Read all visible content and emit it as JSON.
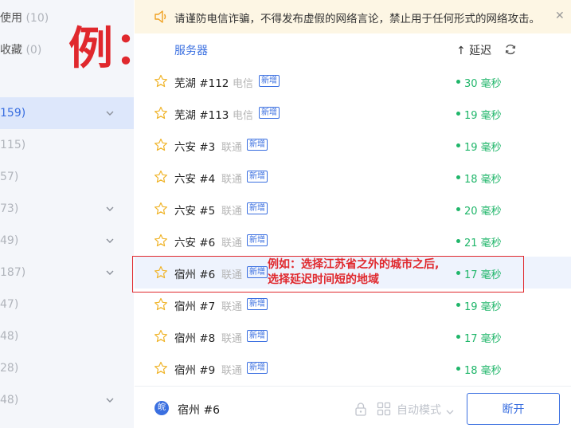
{
  "sidebar": {
    "items": [
      {
        "name": "使用",
        "count": "(10)"
      },
      {
        "name": "收藏",
        "count": "(0)"
      },
      {
        "name": "",
        "count": "159)"
      },
      {
        "name": "",
        "count": "115)"
      },
      {
        "name": "",
        "count": "57)"
      },
      {
        "name": "",
        "count": "73)"
      },
      {
        "name": "",
        "count": "49)"
      },
      {
        "name": "",
        "count": "187)"
      },
      {
        "name": "",
        "count": "47)"
      },
      {
        "name": "",
        "count": "48)"
      },
      {
        "name": "",
        "count": "28)"
      },
      {
        "name": "",
        "count": "48)"
      }
    ],
    "example_label": "例："
  },
  "notice": {
    "text": "请谨防电信诈骗，不得发布虚假的网络言论，禁止用于任何形式的网络攻击。",
    "close": "✕"
  },
  "header": {
    "server_col": "服务器",
    "latency_col": "↑ 延迟"
  },
  "servers": [
    {
      "name": "芜湖 #112",
      "isp": "电信",
      "badge": "新增",
      "latency": "30 毫秒"
    },
    {
      "name": "芜湖 #113",
      "isp": "电信",
      "badge": "新增",
      "latency": "19 毫秒"
    },
    {
      "name": "六安 #3",
      "isp": "联通",
      "badge": "新增",
      "latency": "19 毫秒"
    },
    {
      "name": "六安 #4",
      "isp": "联通",
      "badge": "新增",
      "latency": "18 毫秒"
    },
    {
      "name": "六安 #5",
      "isp": "联通",
      "badge": "新增",
      "latency": "20 毫秒"
    },
    {
      "name": "六安 #6",
      "isp": "联通",
      "badge": "新增",
      "latency": "21 毫秒"
    },
    {
      "name": "宿州 #6",
      "isp": "联通",
      "badge": "新增",
      "latency": "17 毫秒"
    },
    {
      "name": "宿州 #7",
      "isp": "联通",
      "badge": "新增",
      "latency": "19 毫秒"
    },
    {
      "name": "宿州 #8",
      "isp": "联通",
      "badge": "新增",
      "latency": "17 毫秒"
    },
    {
      "name": "宿州 #9",
      "isp": "联通",
      "badge": "新增",
      "latency": "18 毫秒"
    }
  ],
  "annotation": {
    "line1": "例如：选择江苏省之外的城市之后,",
    "line2": "选择延迟时间短的地域"
  },
  "bottom": {
    "region_icon": "皖",
    "current_server": "宿州 #6",
    "mode": "自动模式",
    "disconnect": "断开"
  },
  "colors": {
    "accent": "#3a6fe0",
    "latency_green": "#20b66a",
    "annotation_red": "#e0282d",
    "notice_bg": "#fdf6e4"
  }
}
